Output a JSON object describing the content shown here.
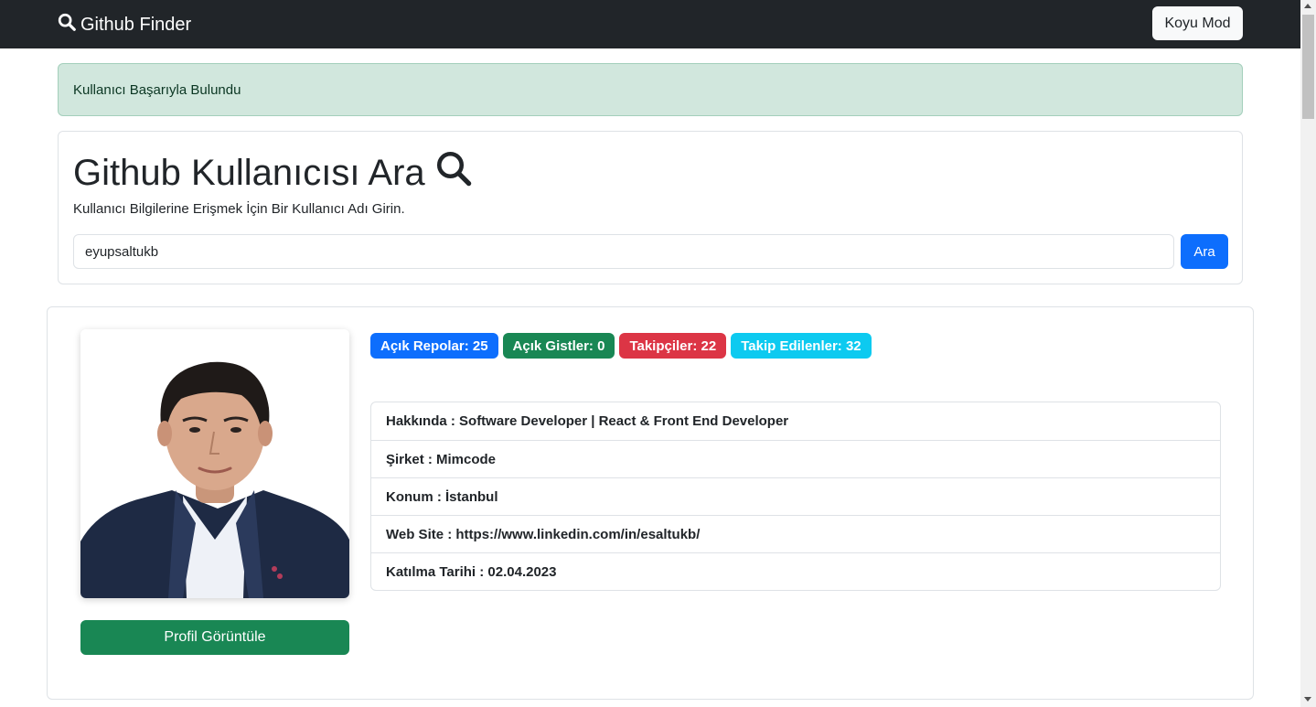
{
  "navbar": {
    "brand": "Github Finder",
    "dark_mode_label": "Koyu Mod"
  },
  "alert": {
    "message": "Kullanıcı Başarıyla Bulundu"
  },
  "search": {
    "title": "Github Kullanıcısı Ara",
    "subtitle": "Kullanıcı Bilgilerine Erişmek İçin Bir Kullanıcı Adı Girin.",
    "input_value": "eyupsaltukb",
    "button_label": "Ara"
  },
  "profile": {
    "view_button_label": "Profil Görüntüle",
    "badges": [
      {
        "label": "Açık Repolar: 25",
        "color": "#0d6efd"
      },
      {
        "label": "Açık Gistler: 0",
        "color": "#198754"
      },
      {
        "label": "Takipçiler: 22",
        "color": "#dc3545"
      },
      {
        "label": "Takip Edilenler: 32",
        "color": "#0dcaf0"
      }
    ],
    "info": [
      "Hakkında : Software Developer | React & Front End Developer",
      "Şirket : Mimcode",
      "Konum : İstanbul",
      "Web Site : https://www.linkedin.com/in/esaltukb/",
      "Katılma Tarihi : 02.04.2023"
    ]
  }
}
